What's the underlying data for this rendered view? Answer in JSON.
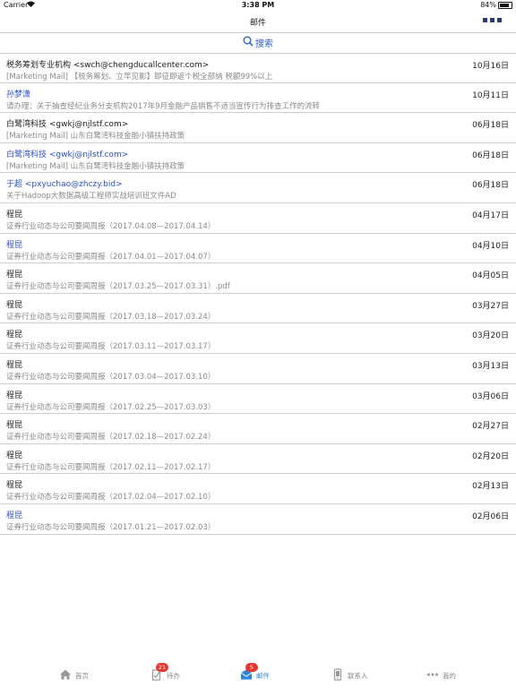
{
  "status_bar": {
    "carrier": "Carrier",
    "time": "3:38 PM",
    "battery": "84%",
    "battery_level": 0.84
  },
  "navbar": {
    "title": "邮件"
  },
  "search": {
    "label": "搜索"
  },
  "mails": [
    {
      "sender": "税务筹划专业机构 <swch@chengducallcenter.com>",
      "subject": "[Marketing Mail] 【税务筹划、立竿见影】即征即返个税全部纳 税额99%以上",
      "date": "10月16日",
      "unread": false
    },
    {
      "sender": "孙梦潇",
      "subject": "请办理：关于抽查经纪业务分支机构2017年9月金融产品销售不适当宣传行为排查工作的流转",
      "date": "10月11日",
      "unread": true
    },
    {
      "sender": "白鹭湾科技 <gwkj@njlstf.com>",
      "subject": "[Marketing Mail] 山东白鹭湾科技金融小镇扶持政策",
      "date": "06月18日",
      "unread": false
    },
    {
      "sender": "白鹭湾科技 <gwkj@njlstf.com>",
      "subject": "[Marketing Mail] 山东白鹭湾科技金融小镇扶持政策",
      "date": "06月18日",
      "unread": true
    },
    {
      "sender": "于超 <pxyuchao@zhczy.bid>",
      "subject": "关于Hadoop大数据高级工程师实战培训班文件AD",
      "date": "06月18日",
      "unread": true
    },
    {
      "sender": "程昆",
      "subject": "证券行业动态与公司要闻周报（2017.04.08—2017.04.14）",
      "date": "04月17日",
      "unread": false
    },
    {
      "sender": "程昆",
      "subject": "证券行业动态与公司要闻周报（2017.04.01—2017.04.07）",
      "date": "04月10日",
      "unread": true
    },
    {
      "sender": "程昆",
      "subject": "证券行业动态与公司要闻周报（2017.03.25—2017.03.31）.pdf",
      "date": "04月05日",
      "unread": false
    },
    {
      "sender": "程昆",
      "subject": "证券行业动态与公司要闻周报（2017.03.18—2017.03.24）",
      "date": "03月27日",
      "unread": false
    },
    {
      "sender": "程昆",
      "subject": "证券行业动态与公司要闻周报（2017.03.11—2017.03.17）",
      "date": "03月20日",
      "unread": false
    },
    {
      "sender": "程昆",
      "subject": "证券行业动态与公司要闻周报（2017.03.04—2017.03.10）",
      "date": "03月13日",
      "unread": false
    },
    {
      "sender": "程昆",
      "subject": "证券行业动态与公司要闻周报（2017.02.25—2017.03.03）",
      "date": "03月06日",
      "unread": false
    },
    {
      "sender": "程昆",
      "subject": "证券行业动态与公司要闻周报（2017.02.18—2017.02.24）",
      "date": "02月27日",
      "unread": false
    },
    {
      "sender": "程昆",
      "subject": "证券行业动态与公司要闻周报（2017.02.11—2017.02.17）",
      "date": "02月20日",
      "unread": false
    },
    {
      "sender": "程昆",
      "subject": "证券行业动态与公司要闻周报（2017.02.04—2017.02.10）",
      "date": "02月13日",
      "unread": false
    },
    {
      "sender": "程昆",
      "subject": "证券行业动态与公司要闻周报（2017.01.21—2017.02.03）",
      "date": "02月06日",
      "unread": true
    }
  ],
  "tabbar": {
    "home": "首页",
    "todo": "待办",
    "todo_badge": "21",
    "mail": "邮件",
    "mail_badge": "5",
    "contacts": "联系人",
    "mine": "我的"
  },
  "colors": {
    "accent": "#2a86e0",
    "unread_sender": "#2a4fd6",
    "badge": "#e8362d",
    "menu_dots": "#2a3b73"
  }
}
